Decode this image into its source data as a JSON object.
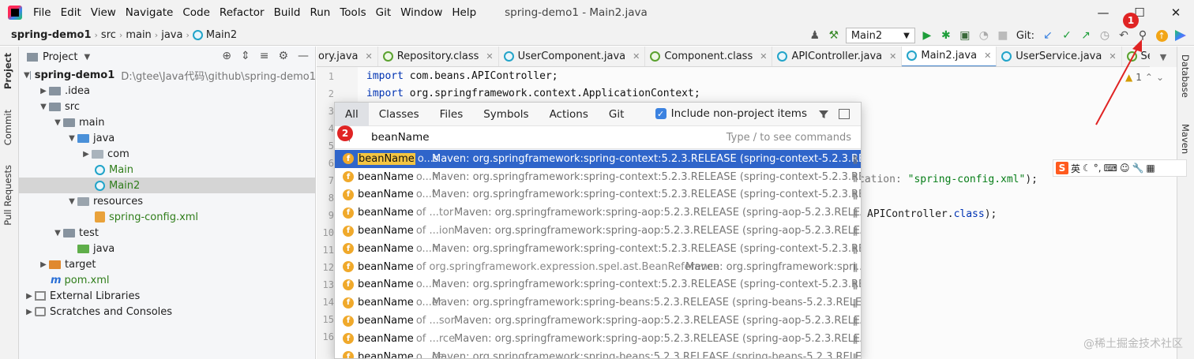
{
  "menubar": {
    "items": [
      "File",
      "Edit",
      "View",
      "Navigate",
      "Code",
      "Refactor",
      "Build",
      "Run",
      "Tools",
      "Git",
      "Window",
      "Help"
    ],
    "window_title": "spring-demo1 - Main2.java"
  },
  "breadcrumb": [
    "spring-demo1",
    "src",
    "main",
    "java",
    "Main2"
  ],
  "toolbar": {
    "run_config": "Main2",
    "git_label": "Git:"
  },
  "left_stripe": [
    "Project",
    "Commit",
    "Pull Requests"
  ],
  "right_stripe": [
    "Database",
    "Maven"
  ],
  "project_panel": {
    "title": "Project",
    "tree": [
      {
        "label": "spring-demo1",
        "extra": "D:\\gtee\\Java代码\\github\\spring-demo1"
      },
      {
        "label": ".idea"
      },
      {
        "label": "src"
      },
      {
        "label": "main"
      },
      {
        "label": "java"
      },
      {
        "label": "com"
      },
      {
        "label": "Main"
      },
      {
        "label": "Main2"
      },
      {
        "label": "resources"
      },
      {
        "label": "spring-config.xml"
      },
      {
        "label": "test"
      },
      {
        "label": "java"
      },
      {
        "label": "target"
      },
      {
        "label": "pom.xml"
      },
      {
        "label": "External Libraries"
      },
      {
        "label": "Scratches and Consoles"
      }
    ]
  },
  "editor_tabs": [
    "ory.java",
    "Repository.class",
    "UserComponent.java",
    "Component.class",
    "APIController.java",
    "Main2.java",
    "UserService.java",
    "Service.class"
  ],
  "editor": {
    "line_numbers": [
      "1",
      "2",
      "3",
      "4",
      "5",
      "6",
      "7",
      "8",
      "9",
      "10",
      "11",
      "12",
      "13",
      "14",
      "15",
      "16"
    ],
    "line1_kw": "import",
    "line1_rest": " com.beans.APIController;",
    "line2_kw": "import",
    "line2_rest": " org.springframework.context.ApplicationContext;",
    "frag_a": "cation: ",
    "frag_a_str": "\"spring-config.xml\"",
    "frag_a_end": ");",
    "frag_b": "APIController.",
    "frag_b_kw": "class",
    "frag_b_end": ");",
    "warning_count": "1"
  },
  "search_popup": {
    "tabs": [
      "All",
      "Classes",
      "Files",
      "Symbols",
      "Actions",
      "Git"
    ],
    "include_label": "Include non-project items",
    "query": "beanName",
    "hint": "Type / to see commands",
    "results": [
      {
        "name": "beanName",
        "ctx": "o...s",
        "loc": "Maven: org.springframework:spring-context:5.2.3.RELEASE (spring-context-5.2.3.RELEASE..."
      },
      {
        "name": "beanName",
        "ctx": "o...n",
        "loc": "Maven: org.springframework:spring-context:5.2.3.RELEASE (spring-context-5.2.3.RELEASE..."
      },
      {
        "name": "beanName",
        "ctx": "o...t",
        "loc": "Maven: org.springframework:spring-context:5.2.3.RELEASE (spring-context-5.2.3.RELEASE..."
      },
      {
        "name": "beanName",
        "ctx": "of ...tor",
        "loc": "Maven: org.springframework:spring-aop:5.2.3.RELEASE (spring-aop-5.2.3.RELEASE.jar)"
      },
      {
        "name": "beanName",
        "ctx": "of ...ion",
        "loc": "Maven: org.springframework:spring-aop:5.2.3.RELEASE (spring-aop-5.2.3.RELEASE.jar)"
      },
      {
        "name": "beanName",
        "ctx": "o...n",
        "loc": "Maven: org.springframework:spring-context:5.2.3.RELEASE (spring-context-5.2.3.RELEASE.jar)"
      },
      {
        "name": "beanName",
        "ctx": "of org.springframework.expression.spel.ast.BeanReference",
        "loc": "Maven: org.springframework:spri..."
      },
      {
        "name": "beanName",
        "ctx": "o...n",
        "loc": "Maven: org.springframework:spring-context:5.2.3.RELEASE (spring-context-5.2.3.RELEASE..."
      },
      {
        "name": "beanName",
        "ctx": "o...er",
        "loc": "Maven: org.springframework:spring-beans:5.2.3.RELEASE (spring-beans-5.2.3.RELEASE.ja..."
      },
      {
        "name": "beanName",
        "ctx": "of ...sor",
        "loc": "Maven: org.springframework:spring-aop:5.2.3.RELEASE (spring-aop-5.2.3.RELEASE.jar)"
      },
      {
        "name": "beanName",
        "ctx": "of ...rce",
        "loc": "Maven: org.springframework:spring-aop:5.2.3.RELEASE (spring-aop-5.2.3.RELEASE.jar)"
      },
      {
        "name": "beanName",
        "ctx": "o...ce",
        "loc": "Maven: org.springframework:spring-beans:5.2.3.RELEASE (spring-beans-5.2.3.RELEASE.ja..."
      }
    ]
  },
  "annotations": {
    "badge1": "1",
    "badge2": "2"
  },
  "watermark": "@稀土掘金技术社区",
  "colors": {
    "accent": "#2f65ca",
    "highlight": "#f4c542",
    "badge": "#e02424",
    "run_green": "#1e9e3a"
  }
}
